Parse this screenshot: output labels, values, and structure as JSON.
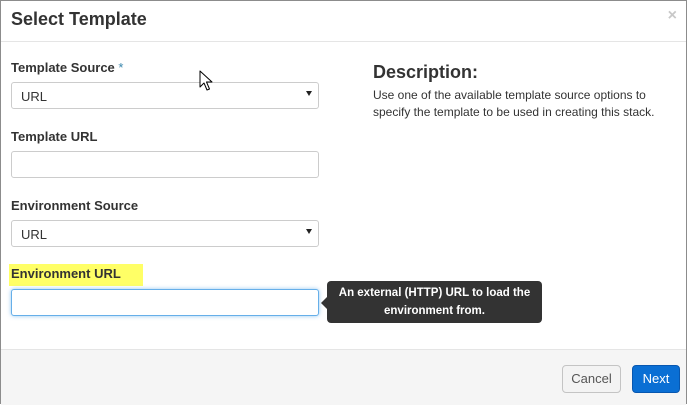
{
  "modal": {
    "title": "Select Template",
    "close_symbol": "×"
  },
  "form": {
    "template_source": {
      "label": "Template Source",
      "required_marker": "*",
      "value": "URL"
    },
    "template_url": {
      "label": "Template URL",
      "value": ""
    },
    "environment_source": {
      "label": "Environment Source",
      "value": "URL"
    },
    "environment_url": {
      "label": "Environment URL",
      "value": "",
      "highlighted": true
    }
  },
  "description": {
    "title": "Description:",
    "text": "Use one of the available template source options to specify the template to be used in creating this stack."
  },
  "tooltip": {
    "line1": "An external (HTTP) URL to load the",
    "line2": "environment from."
  },
  "footer": {
    "cancel_label": "Cancel",
    "next_label": "Next"
  },
  "colors": {
    "primary": "#0a6fd4",
    "highlight": "#ffff66",
    "required": "#3a87ad",
    "tooltip_bg": "#333333"
  },
  "icons": {
    "close": "close-icon",
    "select_arrow": "caret-down-icon",
    "cursor": "mouse-pointer-icon"
  }
}
